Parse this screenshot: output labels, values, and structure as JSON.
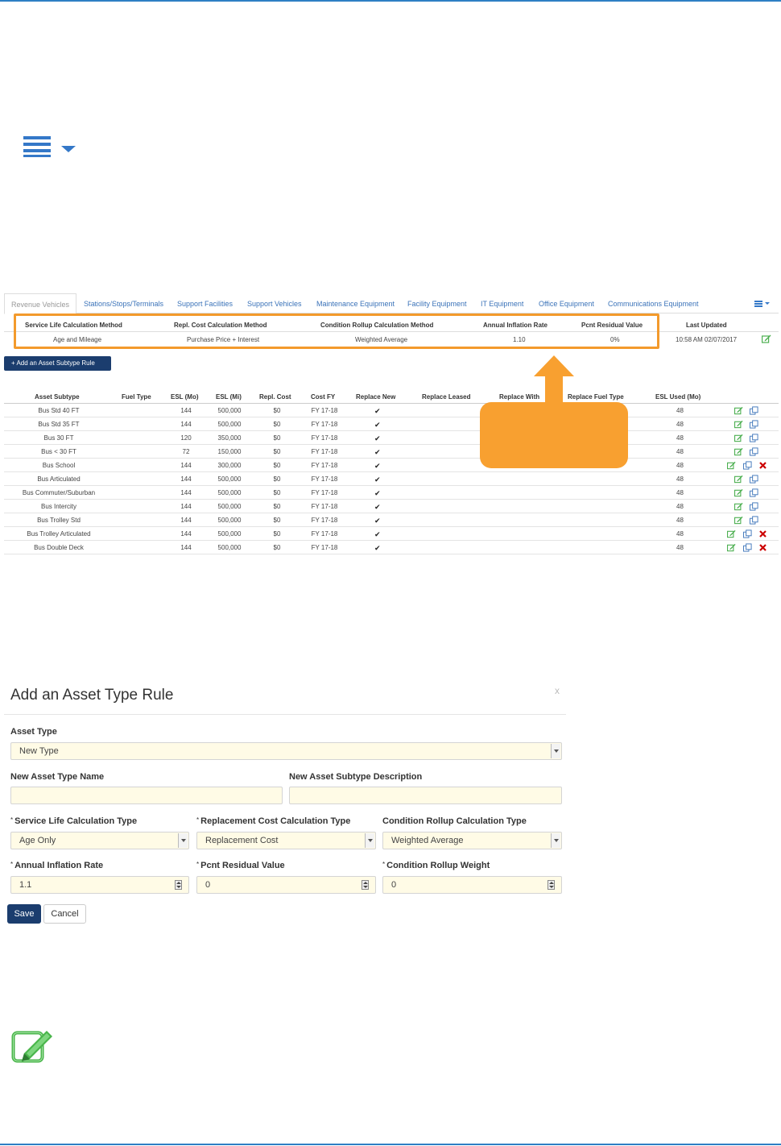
{
  "tabs": {
    "items": [
      "Revenue Vehicles",
      "Stations/Stops/Terminals",
      "Support Facilities",
      "Support Vehicles",
      "Maintenance Equipment",
      "Facility Equipment",
      "IT Equipment",
      "Office Equipment",
      "Communications Equipment"
    ],
    "active_index": 0
  },
  "summary": {
    "headers": {
      "service_life": "Service Life Calculation Method",
      "repl_cost": "Repl. Cost Calculation Method",
      "condition": "Condition Rollup Calculation Method",
      "inflation": "Annual Inflation Rate",
      "residual": "Pcnt Residual Value",
      "updated": "Last Updated"
    },
    "values": {
      "service_life": "Age and Mileage",
      "repl_cost": "Purchase Price + Interest",
      "condition": "Weighted Average",
      "inflation": "1.10",
      "residual": "0%",
      "updated": "10:58 AM 02/07/2017"
    }
  },
  "add_subtype_button": "+ Add an Asset Subtype Rule",
  "subtype_table": {
    "headers": {
      "subtype": "Asset Subtype",
      "fuel": "Fuel Type",
      "esl_mo": "ESL (Mo)",
      "esl_mi": "ESL (Mi)",
      "repl_cost": "Repl. Cost",
      "cost_fy": "Cost FY",
      "replace_new": "Replace New",
      "replace_leased": "Replace Leased",
      "replace_with": "Replace With",
      "replace_fuel": "Replace Fuel Type",
      "esl_used": "ESL Used (Mo)"
    },
    "rows": [
      {
        "subtype": "Bus Std 40 FT",
        "esl_mo": "144",
        "esl_mi": "500,000",
        "cost": "$0",
        "fy": "FY 17-18",
        "esl_used": "48",
        "deletable": false
      },
      {
        "subtype": "Bus Std 35 FT",
        "esl_mo": "144",
        "esl_mi": "500,000",
        "cost": "$0",
        "fy": "FY 17-18",
        "esl_used": "48",
        "deletable": false
      },
      {
        "subtype": "Bus 30 FT",
        "esl_mo": "120",
        "esl_mi": "350,000",
        "cost": "$0",
        "fy": "FY 17-18",
        "esl_used": "48",
        "deletable": false
      },
      {
        "subtype": "Bus < 30 FT",
        "esl_mo": "72",
        "esl_mi": "150,000",
        "cost": "$0",
        "fy": "FY 17-18",
        "esl_used": "48",
        "deletable": false
      },
      {
        "subtype": "Bus School",
        "esl_mo": "144",
        "esl_mi": "300,000",
        "cost": "$0",
        "fy": "FY 17-18",
        "esl_used": "48",
        "deletable": true
      },
      {
        "subtype": "Bus Articulated",
        "esl_mo": "144",
        "esl_mi": "500,000",
        "cost": "$0",
        "fy": "FY 17-18",
        "esl_used": "48",
        "deletable": false
      },
      {
        "subtype": "Bus Commuter/Suburban",
        "esl_mo": "144",
        "esl_mi": "500,000",
        "cost": "$0",
        "fy": "FY 17-18",
        "esl_used": "48",
        "deletable": false
      },
      {
        "subtype": "Bus Intercity",
        "esl_mo": "144",
        "esl_mi": "500,000",
        "cost": "$0",
        "fy": "FY 17-18",
        "esl_used": "48",
        "deletable": false
      },
      {
        "subtype": "Bus Trolley Std",
        "esl_mo": "144",
        "esl_mi": "500,000",
        "cost": "$0",
        "fy": "FY 17-18",
        "esl_used": "48",
        "deletable": false
      },
      {
        "subtype": "Bus Trolley Articulated",
        "esl_mo": "144",
        "esl_mi": "500,000",
        "cost": "$0",
        "fy": "FY 17-18",
        "esl_used": "48",
        "deletable": true
      },
      {
        "subtype": "Bus Double Deck",
        "esl_mo": "144",
        "esl_mi": "500,000",
        "cost": "$0",
        "fy": "FY 17-18",
        "esl_used": "48",
        "deletable": true
      }
    ]
  },
  "dialog": {
    "title": "Add an Asset Type Rule",
    "close": "x",
    "asset_type": {
      "label": "Asset Type",
      "value": "New Type"
    },
    "new_type_name": {
      "label": "New Asset Type Name",
      "value": ""
    },
    "new_subtype_desc": {
      "label": "New Asset Subtype Description",
      "value": ""
    },
    "service_life_type": {
      "label": "Service Life Calculation Type",
      "value": "Age Only"
    },
    "repl_cost_type": {
      "label": "Replacement Cost Calculation Type",
      "value": "Replacement Cost"
    },
    "condition_type": {
      "label": "Condition Rollup Calculation Type",
      "value": "Weighted Average"
    },
    "inflation_rate": {
      "label": "Annual Inflation Rate",
      "value": "1.1"
    },
    "residual_value": {
      "label": "Pcnt Residual Value",
      "value": "0"
    },
    "rollup_weight": {
      "label": "Condition Rollup Weight",
      "value": "0"
    },
    "required_marker": "*",
    "save": "Save",
    "cancel": "Cancel"
  },
  "colors": {
    "accent": "#1b3d6e",
    "link": "#3b73b9",
    "highlight": "#f39a2c",
    "edit_icon": "#4caf50",
    "delete_icon": "#cc0000"
  }
}
